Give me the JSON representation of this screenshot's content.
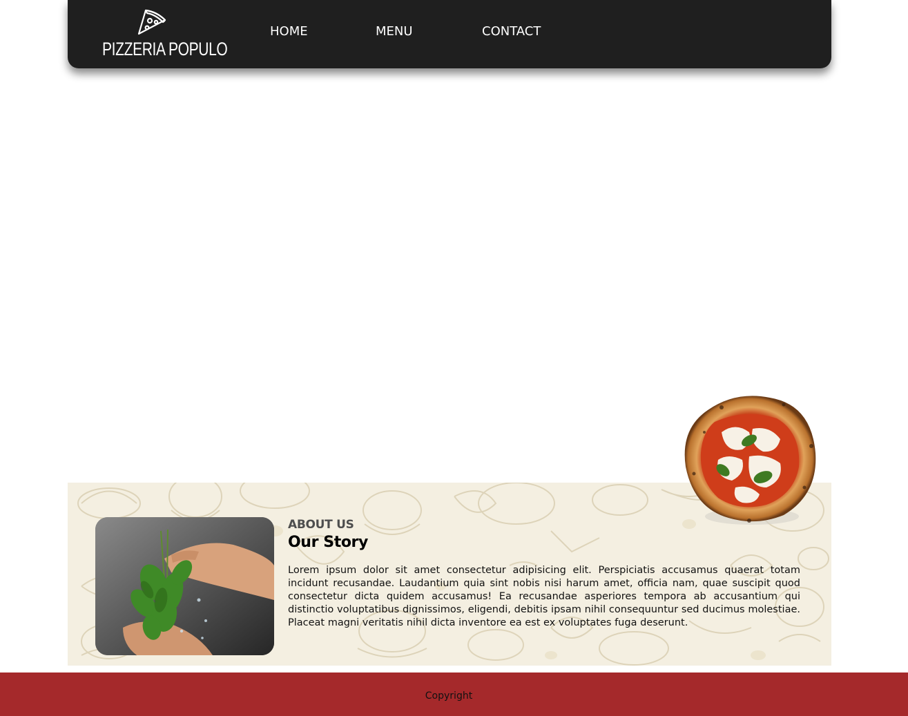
{
  "header": {
    "logo_text": "PIZZERIA POPULO",
    "logo_icon": "pizza-slice-icon",
    "nav": {
      "home": "HOME",
      "menu": "MENU",
      "contact": "CONTACT"
    }
  },
  "about": {
    "eyebrow": "ABOUT US",
    "title": "Our Story",
    "body": "Lorem ipsum dolor sit amet consectetur adipisicing elit. Perspiciatis accusamus quaerat totam incidunt recusandae. Laudantium quia sint nobis nisi harum amet, officia nam, quae suscipit quod consectetur dicta quidem accusamus! Ea recusandae asperiores tempora ab accusantium qui distinctio voluptatibus dignissimos, eligendi, debitis ipsam nihil consequuntur sed ducimus molestiae. Placeat magni veritatis nihil dicta inventore ea est ex voluptates fuga deserunt.",
    "image": "basil-washing-photo"
  },
  "decoration": {
    "pizza": "margherita-pizza-photo"
  },
  "footer": {
    "text": "Copyright"
  },
  "colors": {
    "header_bg": "#1f1f1f",
    "about_bg": "#f4efe1",
    "footer_bg": "#a5292b",
    "text_light": "#ffffff"
  }
}
